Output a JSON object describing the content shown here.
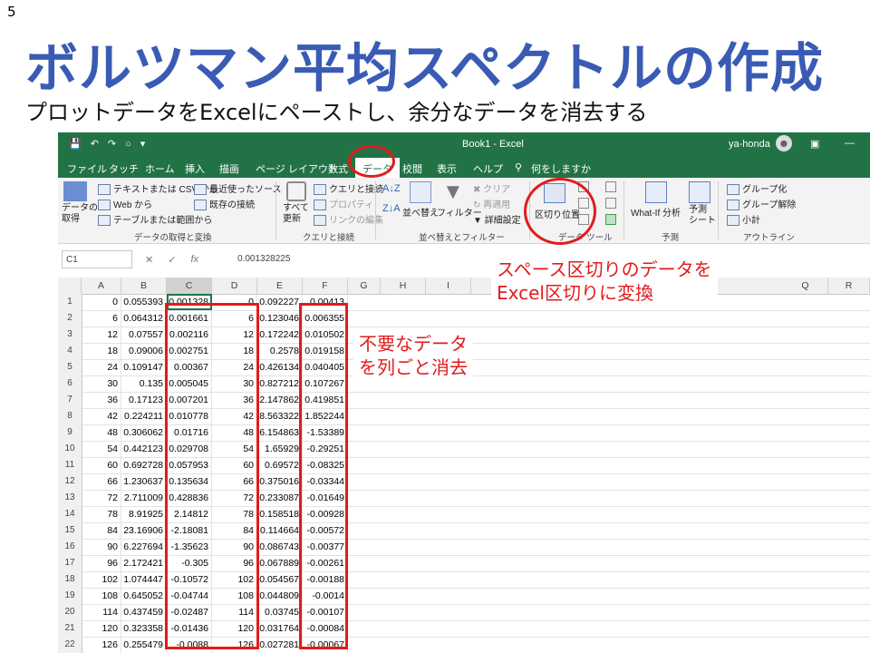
{
  "slide": {
    "number": "5",
    "title": "ボルツマン平均スペクトルの作成",
    "subtitle": "プロットデータをExcelにペーストし、余分なデータを消去する"
  },
  "excel": {
    "document_title": "Book1 - Excel",
    "user": "ya-honda",
    "tabs": [
      "ファイル",
      "タッチ",
      "ホーム",
      "挿入",
      "描画",
      "ページ レイアウト",
      "数式",
      "データ",
      "校閲",
      "表示",
      "ヘルプ",
      "何をしますか"
    ],
    "ribbon": {
      "get_data": "データの\n取得",
      "from_text_csv": "テキストまたは CSV から",
      "from_web": "Web から",
      "from_table": "テーブルまたは範囲から",
      "recent_sources": "最近使ったソース",
      "existing_conn": "既存の接続",
      "group_get": "データの取得と変換",
      "refresh_all": "すべて\n更新",
      "queries_conn": "クエリと接続",
      "properties": "プロパティ",
      "edit_links": "リンクの編集",
      "group_query": "クエリと接続",
      "sort": "並べ替え",
      "filter": "フィルター",
      "clear": "クリア",
      "reapply": "再適用",
      "advanced": "詳細設定",
      "group_sort": "並べ替えとフィルター",
      "text_to_columns": "区切り位置",
      "group_tools": "データ ツール",
      "whatif": "What-If 分析",
      "forecast": "予測\nシート",
      "group_forecast": "予測",
      "group_btn": "グループ化",
      "ungroup_btn": "グループ解除",
      "subtotal": "小計",
      "group_outline": "アウトライン"
    },
    "namebox": "C1",
    "formula": "0.001328225",
    "columns": [
      "A",
      "B",
      "C",
      "D",
      "E",
      "F",
      "G",
      "H",
      "I",
      "",
      "",
      "",
      "",
      "",
      "",
      "Q",
      "R"
    ],
    "rows": [
      [
        "0",
        "0.055393",
        "0.001328",
        "0",
        "0.092227",
        "0.00413"
      ],
      [
        "6",
        "0.064312",
        "0.001661",
        "6",
        "0.123046",
        "0.006355"
      ],
      [
        "12",
        "0.07557",
        "0.002116",
        "12",
        "0.172242",
        "0.010502"
      ],
      [
        "18",
        "0.09006",
        "0.002751",
        "18",
        "0.2578",
        "0.019158"
      ],
      [
        "24",
        "0.109147",
        "0.00367",
        "24",
        "0.426134",
        "0.040405"
      ],
      [
        "30",
        "0.135",
        "0.005045",
        "30",
        "0.827212",
        "0.107267"
      ],
      [
        "36",
        "0.17123",
        "0.007201",
        "36",
        "2.147862",
        "0.419851"
      ],
      [
        "42",
        "0.224211",
        "0.010778",
        "42",
        "8.563322",
        "1.852244"
      ],
      [
        "48",
        "0.306062",
        "0.01716",
        "48",
        "6.154863",
        "-1.53389"
      ],
      [
        "54",
        "0.442123",
        "0.029708",
        "54",
        "1.65929",
        "-0.29251"
      ],
      [
        "60",
        "0.692728",
        "0.057953",
        "60",
        "0.69572",
        "-0.08325"
      ],
      [
        "66",
        "1.230637",
        "0.135634",
        "66",
        "0.375016",
        "-0.03344"
      ],
      [
        "72",
        "2.711009",
        "0.428836",
        "72",
        "0.233087",
        "-0.01649"
      ],
      [
        "78",
        "8.91925",
        "2.14812",
        "78",
        "0.158518",
        "-0.00928"
      ],
      [
        "84",
        "23.16906",
        "-2.18081",
        "84",
        "0.114664",
        "-0.00572"
      ],
      [
        "90",
        "6.227694",
        "-1.35623",
        "90",
        "0.086743",
        "-0.00377"
      ],
      [
        "96",
        "2.172421",
        "-0.305",
        "96",
        "0.067889",
        "-0.00261"
      ],
      [
        "102",
        "1.074447",
        "-0.10572",
        "102",
        "0.054567",
        "-0.00188"
      ],
      [
        "108",
        "0.645052",
        "-0.04744",
        "108",
        "0.044809",
        "-0.0014"
      ],
      [
        "114",
        "0.437459",
        "-0.02487",
        "114",
        "0.03745",
        "-0.00107"
      ],
      [
        "120",
        "0.323358",
        "-0.01436",
        "120",
        "0.031764",
        "-0.00084"
      ],
      [
        "126",
        "0.255479",
        "-0.0088",
        "126",
        "0.027281",
        "-0.00067"
      ]
    ]
  },
  "annotations": {
    "convert_line1": "スペース区切りのデータを",
    "convert_line2": "Excel区切りに変換",
    "delete_line1": "不要なデータ",
    "delete_line2": "を列ごと消去"
  },
  "colors": {
    "title": "#3a5bb5",
    "excel_green": "#217346",
    "highlight_red": "#e21b1b"
  }
}
